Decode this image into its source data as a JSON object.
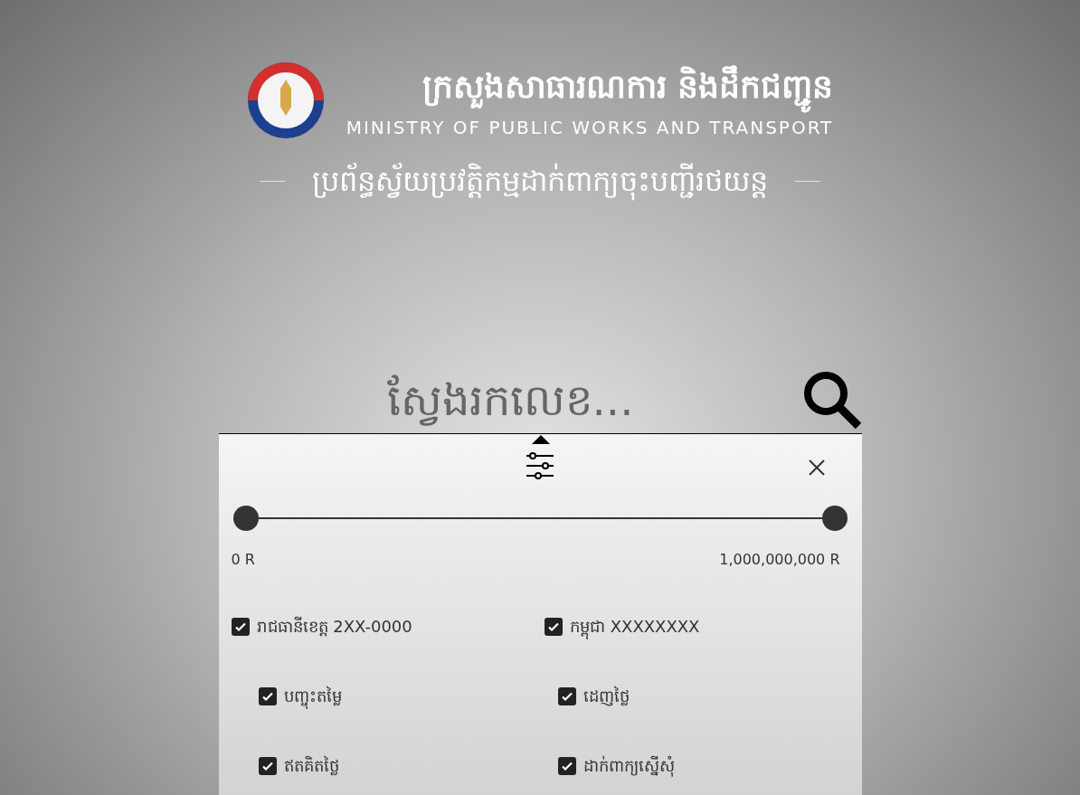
{
  "header": {
    "title_km": "ក្រសួងសាធារណការ និងដឹកជញ្ជូន",
    "title_en": "MINISTRY OF PUBLIC WORKS AND TRANSPORT",
    "subtitle": "ប្រព័ន្ធស្វ័យប្រវត្តិកម្មដាក់ពាក្យចុះបញ្ជីរថយន្ត"
  },
  "search": {
    "placeholder": "ស្វែងរកលេខ..."
  },
  "filter_panel": {
    "price_range": {
      "thumbs": [
        {
          "level": 0
        },
        {
          "level": 1
        }
      ],
      "min_label": "0 R",
      "max_label": "1,000,000,000 R"
    },
    "plate_types": [
      {
        "label": "រាជធានីខេត្ត 2XX-0000",
        "checked": true
      },
      {
        "label": "កម្ពុជា XXXXXXXX",
        "checked": true
      }
    ],
    "sale_types": [
      {
        "label": "បញ្ចុះតម្លៃ",
        "checked": true
      },
      {
        "label": "ដេញថ្លៃ",
        "checked": true
      },
      {
        "label": "ឥតគិតថ្លៃ",
        "checked": true
      },
      {
        "label": "ដាក់ពាក្យស្នើសុំ",
        "checked": true
      }
    ]
  }
}
